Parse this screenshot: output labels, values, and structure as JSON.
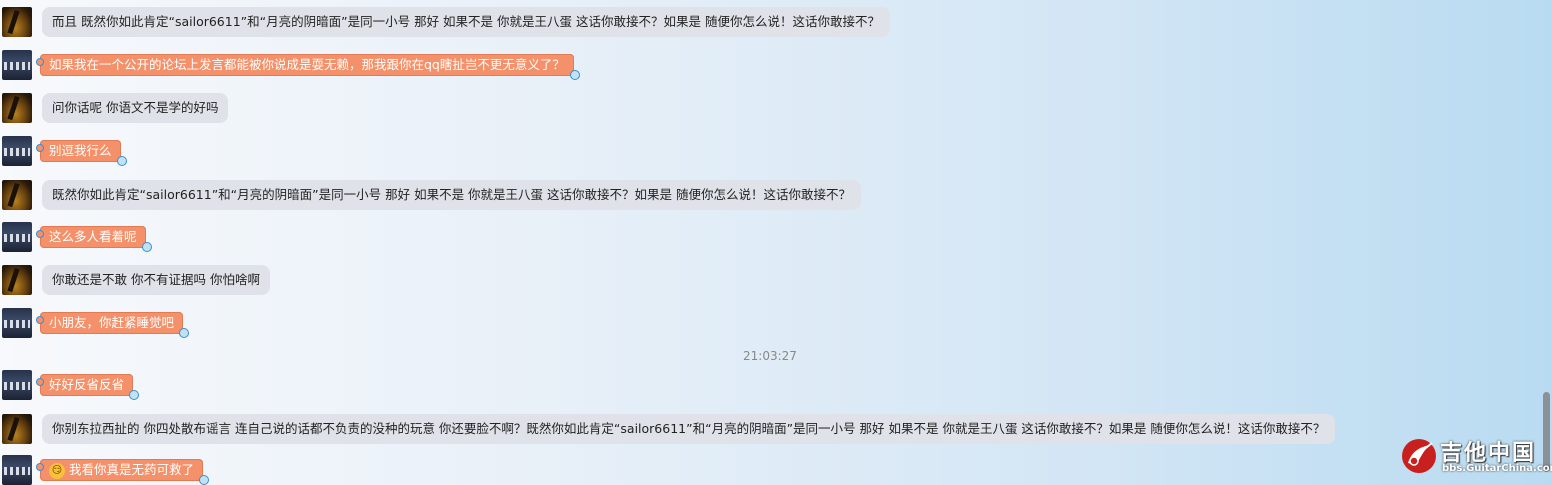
{
  "messages": [
    {
      "sender": "a",
      "style": "gray",
      "text": "而且 既然你如此肯定“sailor6611”和“月亮的阴暗面”是同一小号 那好 如果不是 你就是王八蛋 这话你敢接不？如果是 随便你怎么说！这话你敢接不？"
    },
    {
      "sender": "b",
      "style": "orange",
      "text": "如果我在一个公开的论坛上发言都能被你说成是耍无赖，那我跟你在qq瞎扯岂不更无意义了？"
    },
    {
      "sender": "a",
      "style": "gray",
      "text": "问你话呢 你语文不是学的好吗"
    },
    {
      "sender": "b",
      "style": "orange",
      "text": "别逗我行么"
    },
    {
      "sender": "a",
      "style": "gray",
      "text": " 既然你如此肯定“sailor6611”和“月亮的阴暗面”是同一小号 那好 如果不是 你就是王八蛋 这话你敢接不？如果是 随便你怎么说！这话你敢接不？"
    },
    {
      "sender": "b",
      "style": "orange",
      "text": "这么多人看着呢"
    },
    {
      "sender": "a",
      "style": "gray",
      "text": "你敢还是不敢 你不有证据吗 你怕啥啊"
    },
    {
      "sender": "b",
      "style": "orange",
      "text": "小朋友，你赶紧睡觉吧"
    },
    {
      "sender": "b",
      "style": "orange",
      "text": "好好反省反省"
    },
    {
      "sender": "a",
      "style": "gray",
      "text": "你别东拉西扯的 你四处散布谣言 连自己说的话都不负责的没种的玩意 你还要脸不啊？既然你如此肯定“sailor6611”和“月亮的阴暗面”是同一小号 那好 如果不是 你就是王八蛋 这话你敢接不？如果是 随便你怎么说！这话你敢接不？"
    },
    {
      "sender": "b",
      "style": "orange",
      "emoji": "smirk-emoji",
      "text": "我看你真是无药可救了"
    }
  ],
  "timestamp": "21:03:27",
  "watermark": {
    "title": "吉他中国",
    "url": "bbs.GuitarChina.com"
  }
}
